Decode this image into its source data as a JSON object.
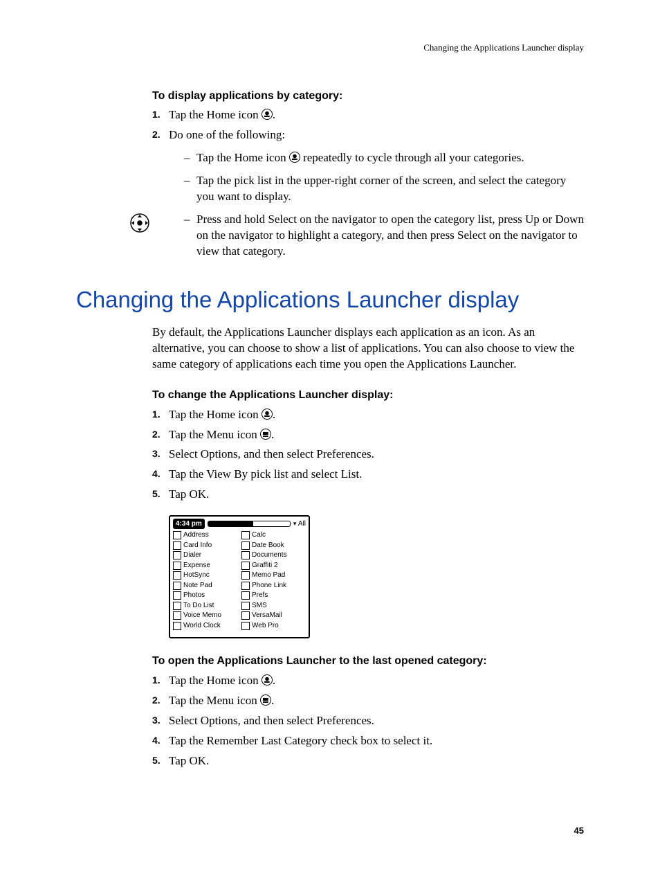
{
  "header": {
    "running_title": "Changing the Applications Launcher display"
  },
  "section1": {
    "subhead": "To display applications by category:",
    "step1_pre": "Tap the Home icon ",
    "step1_post": ".",
    "step2_intro": "Do one of the following:",
    "bullet1_pre": "Tap the Home icon ",
    "bullet1_post": " repeatedly to cycle through all your categories.",
    "bullet2": "Tap the pick list in the upper-right corner of the screen, and select the category you want to display.",
    "bullet3": "Press and hold Select on the navigator to open the category list, press Up or Down on the navigator to highlight a category, and then press Select on the navigator to view that category."
  },
  "title": "Changing the Applications Launcher display",
  "intro": "By default, the Applications Launcher displays each application as an icon. As an alternative, you can choose to show a list of applications. You can also choose to view the same category of applications each time you open the Applications Launcher.",
  "section2": {
    "subhead": "To change the Applications Launcher display:",
    "step1_pre": "Tap the Home icon ",
    "step1_post": ".",
    "step2_pre": "Tap the Menu icon ",
    "step2_post": ".",
    "step3": "Select Options, and then select Preferences.",
    "step4": "Tap the View By pick list and select List.",
    "step5": "Tap OK."
  },
  "palm": {
    "time": "4:34 pm",
    "category": "All",
    "apps_left": [
      "Address",
      "Card Info",
      "Dialer",
      "Expense",
      "HotSync",
      "Note Pad",
      "Photos",
      "To Do List",
      "Voice Memo",
      "World Clock"
    ],
    "apps_right": [
      "Calc",
      "Date Book",
      "Documents",
      "Graffiti 2",
      "Memo Pad",
      "Phone Link",
      "Prefs",
      "SMS",
      "VersaMail",
      "Web Pro"
    ]
  },
  "section3": {
    "subhead": "To open the Applications Launcher to the last opened category:",
    "step1_pre": "Tap the Home icon ",
    "step1_post": ".",
    "step2_pre": "Tap the Menu icon ",
    "step2_post": ".",
    "step3": "Select Options, and then select Preferences.",
    "step4": "Tap the Remember Last Category check box to select it.",
    "step5": "Tap OK."
  },
  "page_number": "45"
}
